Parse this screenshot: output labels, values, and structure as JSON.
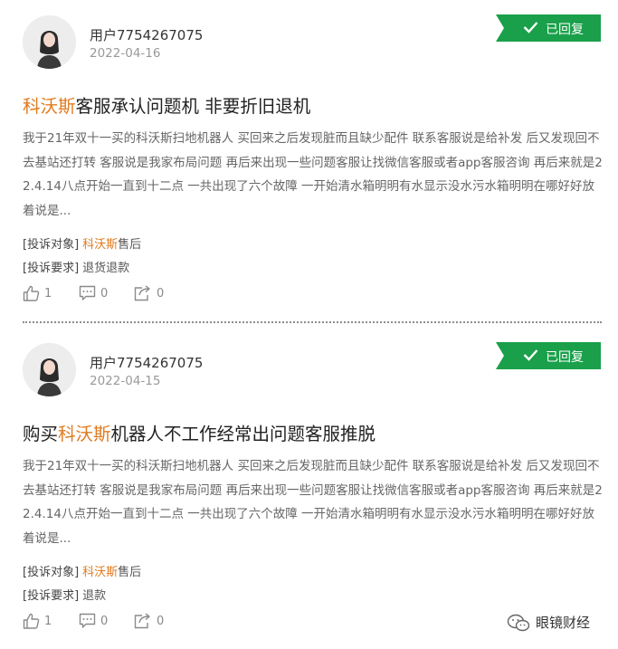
{
  "posts": [
    {
      "username": "用户7754267075",
      "date": "2022-04-16",
      "status": "已回复",
      "title_brand": "科沃斯",
      "title_before": "",
      "title_after": "客服承认问题机 非要折旧退机",
      "body": "我于21年双十一买的科沃斯扫地机器人 买回来之后发现脏而且缺少配件 联系客服说是给补发 后又发现回不去基站还打转 客服说是我家布局问题 再后来出现一些问题客服让找微信客服或者app客服咨询 再后来就是22.4.14八点开始一直到十二点 一共出现了六个故障 一开始清水箱明明有水显示没水污水箱明明在哪好好放着说是...",
      "target_label": "[投诉对象]",
      "target_brand": "科沃斯",
      "target_rest": "售后",
      "demand_label": "[投诉要求]",
      "demand_value": "退货退款",
      "likes": "1",
      "comments": "0",
      "shares": "0"
    },
    {
      "username": "用户7754267075",
      "date": "2022-04-15",
      "status": "已回复",
      "title_before": "购买",
      "title_brand": "科沃斯",
      "title_after": "机器人不工作经常出问题客服推脱",
      "body": "我于21年双十一买的科沃斯扫地机器人 买回来之后发现脏而且缺少配件 联系客服说是给补发 后又发现回不去基站还打转 客服说是我家布局问题 再后来出现一些问题客服让找微信客服或者app客服咨询 再后来就是22.4.14八点开始一直到十二点 一共出现了六个故障 一开始清水箱明明有水显示没水污水箱明明在哪好好放着说是...",
      "target_label": "[投诉对象]",
      "target_brand": "科沃斯",
      "target_rest": "售后",
      "demand_label": "[投诉要求]",
      "demand_value": "退款",
      "likes": "1",
      "comments": "0",
      "shares": "0"
    }
  ],
  "watermark": "眼镜财经",
  "colors": {
    "brand_orange": "#e07b1f",
    "status_green": "#1aa04a"
  }
}
